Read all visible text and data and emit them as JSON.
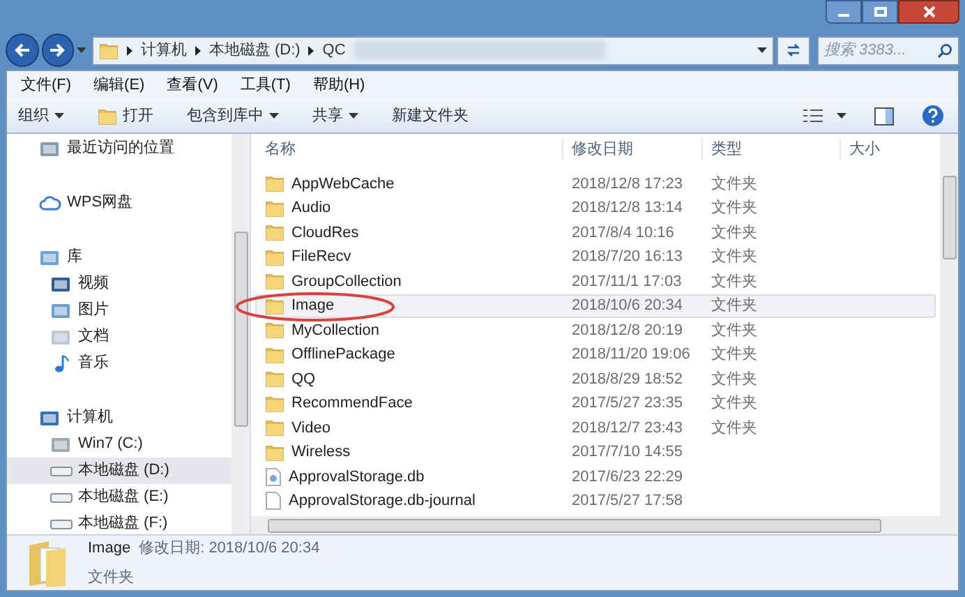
{
  "address_bar": {
    "crumbs": [
      "计算机",
      "本地磁盘 (D:)",
      "QC"
    ]
  },
  "search": {
    "placeholder": "搜索 3383..."
  },
  "menu_bar": [
    "文件(F)",
    "编辑(E)",
    "查看(V)",
    "工具(T)",
    "帮助(H)"
  ],
  "toolbar": [
    {
      "label": "组织",
      "kind": "dropdown"
    },
    {
      "label": "打开",
      "kind": "open"
    },
    {
      "label": "包含到库中",
      "kind": "dropdown"
    },
    {
      "label": "共享",
      "kind": "dropdown"
    },
    {
      "label": "新建文件夹",
      "kind": "plain"
    }
  ],
  "nav_pane": [
    {
      "label": "最近访问的位置",
      "kind": "recent",
      "selected": false
    },
    {
      "label": "WPS网盘",
      "kind": "cloud",
      "selected": false
    },
    {
      "label": "库",
      "kind": "library",
      "selected": false,
      "children": [
        {
          "label": "视频",
          "kind": "video",
          "selected": false
        },
        {
          "label": "图片",
          "kind": "picture",
          "selected": false
        },
        {
          "label": "文档",
          "kind": "document",
          "selected": false
        },
        {
          "label": "音乐",
          "kind": "music",
          "selected": false
        }
      ]
    },
    {
      "label": "计算机",
      "kind": "computer",
      "selected": false,
      "children": [
        {
          "label": "Win7 (C:)",
          "kind": "system-drive",
          "selected": false
        },
        {
          "label": "本地磁盘 (D:)",
          "kind": "drive",
          "selected": true
        },
        {
          "label": "本地磁盘 (E:)",
          "kind": "drive",
          "selected": false
        },
        {
          "label": "本地磁盘 (F:)",
          "kind": "drive",
          "selected": false
        }
      ]
    }
  ],
  "file_list": {
    "columns": [
      "名称",
      "修改日期",
      "类型",
      "大小"
    ],
    "rows": [
      {
        "name": "AppWebCache",
        "date": "2018/12/8 17:23",
        "type": "文件夹",
        "kind": "folder",
        "selected": false
      },
      {
        "name": "Audio",
        "date": "2018/12/8 13:14",
        "type": "文件夹",
        "kind": "folder",
        "selected": false
      },
      {
        "name": "CloudRes",
        "date": "2017/8/4 10:16",
        "type": "文件夹",
        "kind": "folder",
        "selected": false
      },
      {
        "name": "FileRecv",
        "date": "2018/7/20 16:13",
        "type": "文件夹",
        "kind": "folder",
        "selected": false
      },
      {
        "name": "GroupCollection",
        "date": "2017/11/1 17:03",
        "type": "文件夹",
        "kind": "folder",
        "selected": false
      },
      {
        "name": "Image",
        "date": "2018/10/6 20:34",
        "type": "文件夹",
        "kind": "folder",
        "selected": true
      },
      {
        "name": "MyCollection",
        "date": "2018/12/8 20:19",
        "type": "文件夹",
        "kind": "folder",
        "selected": false
      },
      {
        "name": "OfflinePackage",
        "date": "2018/11/20 19:06",
        "type": "文件夹",
        "kind": "folder",
        "selected": false
      },
      {
        "name": "QQ",
        "date": "2018/8/29 18:52",
        "type": "文件夹",
        "kind": "folder",
        "selected": false
      },
      {
        "name": "RecommendFace",
        "date": "2017/5/27 23:35",
        "type": "文件夹",
        "kind": "folder",
        "selected": false
      },
      {
        "name": "Video",
        "date": "2018/12/7 23:43",
        "type": "文件夹",
        "kind": "folder",
        "selected": false
      },
      {
        "name": "Wireless",
        "date": "2017/7/10 14:55",
        "kind": "folder",
        "selected": false
      },
      {
        "name": "ApprovalStorage.db",
        "date": "2017/6/23 22:29",
        "kind": "db",
        "selected": false
      },
      {
        "name": "ApprovalStorage.db-journal",
        "date": "2017/5/27 17:58",
        "kind": "file",
        "selected": false
      }
    ]
  },
  "details_pane": {
    "name": "Image",
    "modified": "修改日期: 2018/10/6 20:34",
    "type": "文件夹"
  }
}
